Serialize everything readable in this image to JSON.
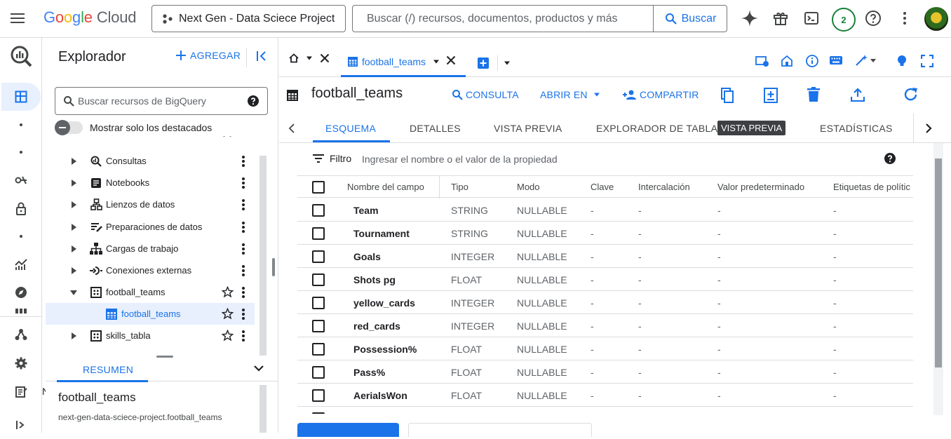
{
  "topbar": {
    "logo_parts": [
      "G",
      "o",
      "o",
      "g",
      "l",
      "e"
    ],
    "logo_cloud": "Cloud",
    "project": "Next Gen - Data Sciece Project",
    "search_placeholder": "Buscar (/) recursos, documentos, productos y más",
    "search_button": "Buscar",
    "notification_count": "2"
  },
  "explorer": {
    "title": "Explorador",
    "add_label": "AGREGAR",
    "search_placeholder": "Buscar recursos de BigQuery",
    "toggle_label": "Mostrar solo los destacados",
    "project_row": "next-gen-data-sciece-project",
    "tree": [
      {
        "label": "Consultas",
        "icon": "search-icon"
      },
      {
        "label": "Notebooks",
        "icon": "notebook-icon"
      },
      {
        "label": "Lienzos de datos",
        "icon": "canvas-icon"
      },
      {
        "label": "Preparaciones de datos",
        "icon": "data-prep-icon"
      },
      {
        "label": "Cargas de trabajo",
        "icon": "workload-icon"
      },
      {
        "label": "Conexiones externas",
        "icon": "connection-icon"
      },
      {
        "label": "football_teams",
        "icon": "dataset-icon"
      },
      {
        "label": "football_teams",
        "icon": "table-icon"
      },
      {
        "label": "skills_tabla",
        "icon": "dataset-icon"
      }
    ],
    "summary_tab": "RESUMEN",
    "summary_title": "football_teams",
    "summary_id": "next-gen-data-sciece-project.football_teams"
  },
  "main": {
    "tab_label": "football_teams",
    "title": "football_teams",
    "actions": {
      "query": "CONSULTA",
      "open_in": "ABRIR EN",
      "share": "COMPARTIR"
    },
    "subtabs": [
      "ESQUEMA",
      "DETALLES",
      "VISTA PREVIA",
      "EXPLORADOR DE TABLAS",
      "ESTADÍSTICAS"
    ],
    "tooltip": "VISTA PREVIA",
    "filter_label": "Filtro",
    "filter_placeholder": "Ingresar el nombre o el valor de la propiedad",
    "columns": [
      "Nombre del campo",
      "Tipo",
      "Modo",
      "Clave",
      "Intercalación",
      "Valor predeterminado",
      "Etiquetas de polític"
    ],
    "rows": [
      [
        "Team",
        "STRING",
        "NULLABLE",
        "-",
        "-",
        "-",
        "-"
      ],
      [
        "Tournament",
        "STRING",
        "NULLABLE",
        "-",
        "-",
        "-",
        "-"
      ],
      [
        "Goals",
        "INTEGER",
        "NULLABLE",
        "-",
        "-",
        "-",
        "-"
      ],
      [
        "Shots pg",
        "FLOAT",
        "NULLABLE",
        "-",
        "-",
        "-",
        "-"
      ],
      [
        "yellow_cards",
        "INTEGER",
        "NULLABLE",
        "-",
        "-",
        "-",
        "-"
      ],
      [
        "red_cards",
        "INTEGER",
        "NULLABLE",
        "-",
        "-",
        "-",
        "-"
      ],
      [
        "Possession%",
        "FLOAT",
        "NULLABLE",
        "-",
        "-",
        "-",
        "-"
      ],
      [
        "Pass%",
        "FLOAT",
        "NULLABLE",
        "-",
        "-",
        "-",
        "-"
      ],
      [
        "AerialsWon",
        "FLOAT",
        "NULLABLE",
        "-",
        "-",
        "-",
        "-"
      ]
    ]
  },
  "colors": {
    "accent": "#1a73e8",
    "selected_bg": "#e8f0fe",
    "badge": "#188038"
  }
}
